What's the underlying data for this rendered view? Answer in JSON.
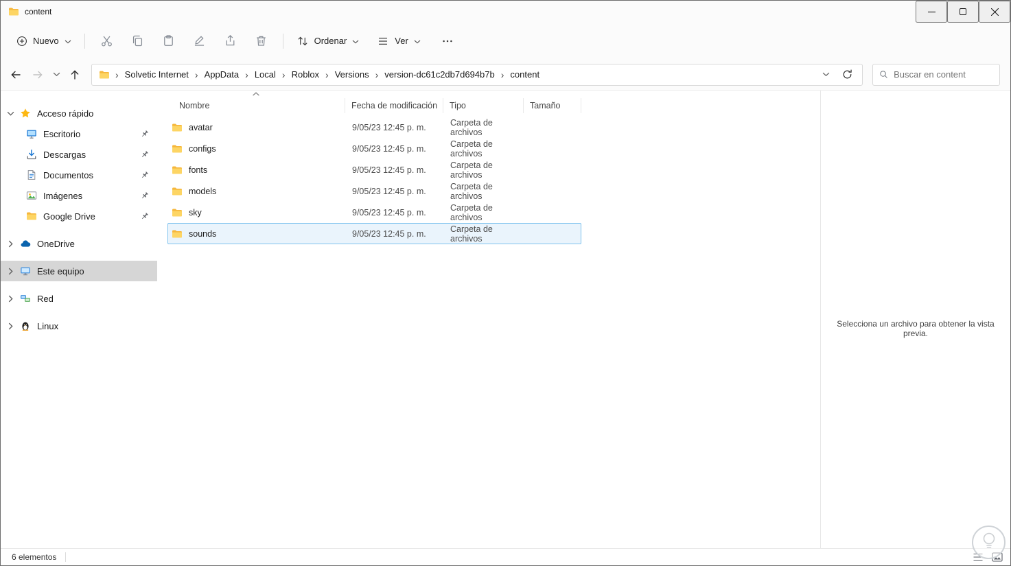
{
  "window": {
    "title": "content"
  },
  "toolbar": {
    "new_label": "Nuevo",
    "actions": [
      "cut",
      "copy",
      "paste",
      "rename",
      "share",
      "delete"
    ],
    "sort_label": "Ordenar",
    "view_label": "Ver"
  },
  "address_bar": {
    "breadcrumbs": [
      "Solvetic Internet",
      "AppData",
      "Local",
      "Roblox",
      "Versions",
      "version-dc61c2db7d694b7b",
      "content"
    ],
    "search_placeholder": "Buscar en content"
  },
  "sidebar": {
    "items": [
      {
        "label": "Acceso rápido",
        "icon": "star",
        "chevron": "down",
        "level": 0
      },
      {
        "label": "Escritorio",
        "icon": "desktop",
        "pinned": true,
        "level": 1
      },
      {
        "label": "Descargas",
        "icon": "download",
        "pinned": true,
        "level": 1
      },
      {
        "label": "Documentos",
        "icon": "document",
        "pinned": true,
        "level": 1
      },
      {
        "label": "Imágenes",
        "icon": "pictures",
        "pinned": true,
        "level": 1
      },
      {
        "label": "Google Drive",
        "icon": "folder",
        "pinned": true,
        "level": 1
      },
      {
        "label": "OneDrive",
        "icon": "cloud",
        "chevron": "right",
        "level": 0,
        "group": true
      },
      {
        "label": "Este equipo",
        "icon": "computer",
        "chevron": "right",
        "level": 0,
        "group": true,
        "selected": true
      },
      {
        "label": "Red",
        "icon": "network",
        "chevron": "right",
        "level": 0,
        "group": true
      },
      {
        "label": "Linux",
        "icon": "linux",
        "chevron": "right",
        "level": 0,
        "group": true
      }
    ]
  },
  "file_list": {
    "columns": [
      {
        "label": "Nombre",
        "sort": "asc"
      },
      {
        "label": "Fecha de modificación"
      },
      {
        "label": "Tipo"
      },
      {
        "label": "Tamaño"
      }
    ],
    "rows": [
      {
        "name": "avatar",
        "modified": "9/05/23 12:45 p. m.",
        "type": "Carpeta de archivos",
        "size": "",
        "icon": "folder"
      },
      {
        "name": "configs",
        "modified": "9/05/23 12:45 p. m.",
        "type": "Carpeta de archivos",
        "size": "",
        "icon": "folder"
      },
      {
        "name": "fonts",
        "modified": "9/05/23 12:45 p. m.",
        "type": "Carpeta de archivos",
        "size": "",
        "icon": "folder"
      },
      {
        "name": "models",
        "modified": "9/05/23 12:45 p. m.",
        "type": "Carpeta de archivos",
        "size": "",
        "icon": "folder"
      },
      {
        "name": "sky",
        "modified": "9/05/23 12:45 p. m.",
        "type": "Carpeta de archivos",
        "size": "",
        "icon": "folder"
      },
      {
        "name": "sounds",
        "modified": "9/05/23 12:45 p. m.",
        "type": "Carpeta de archivos",
        "size": "",
        "icon": "folder",
        "selected": true
      }
    ]
  },
  "preview_pane": {
    "message": "Selecciona un archivo para obtener la vista previa."
  },
  "status_bar": {
    "items_count": "6 elementos"
  }
}
